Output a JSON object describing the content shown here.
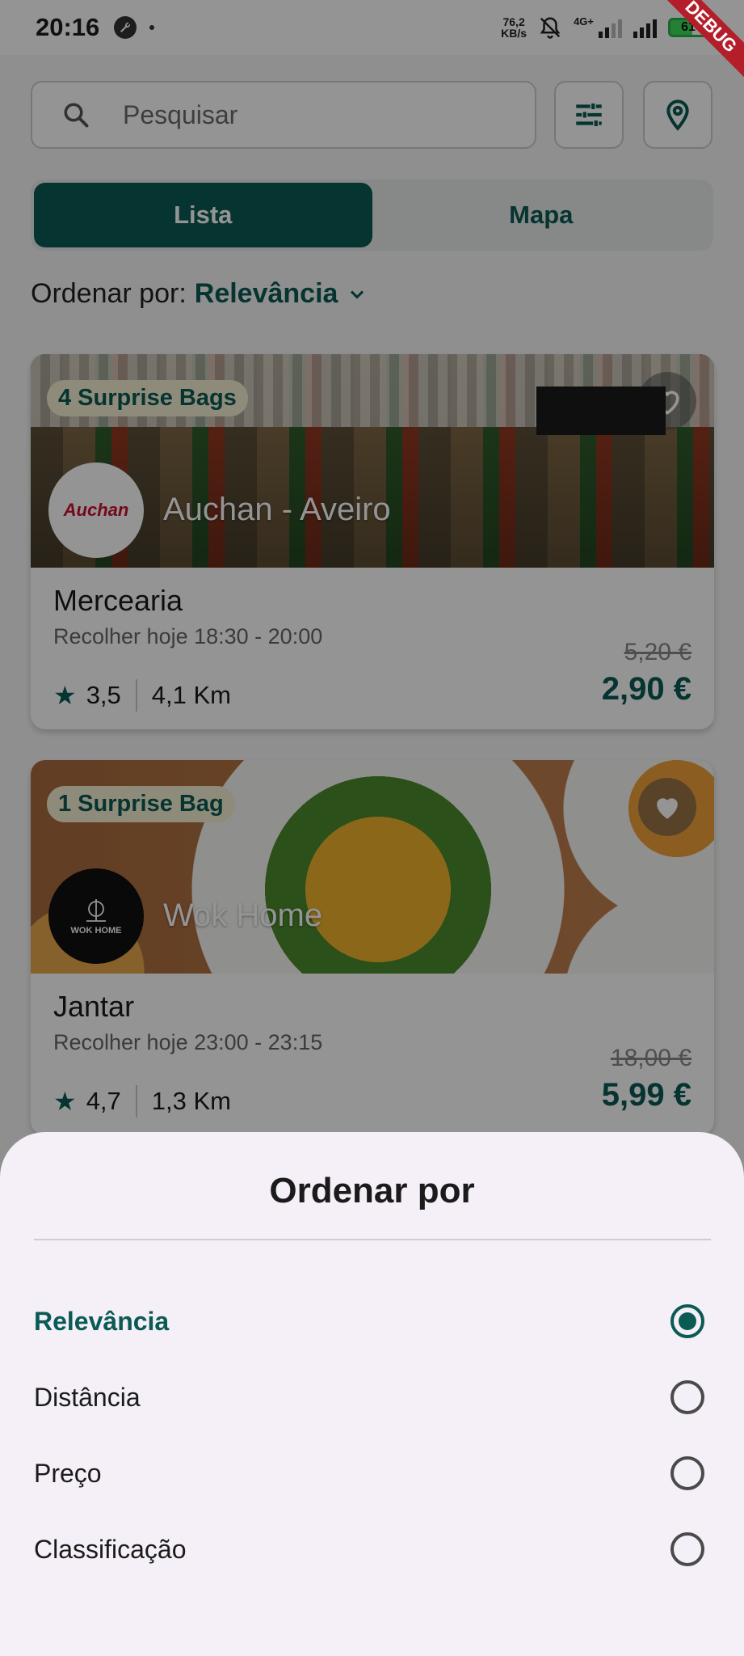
{
  "status_bar": {
    "time": "20:16",
    "net_speed_value": "76,2",
    "net_speed_unit": "KB/s",
    "network": "4G+",
    "battery": "61"
  },
  "debug_banner": "DEBUG",
  "search": {
    "placeholder": "Pesquisar"
  },
  "view_toggle": {
    "list_label": "Lista",
    "map_label": "Mapa",
    "active": "Lista"
  },
  "sort": {
    "label": "Ordenar por:",
    "value": "Relevância"
  },
  "cards": [
    {
      "badge": "4 Surprise Bags",
      "logo_text": "Auchan",
      "store": "Auchan - Aveiro",
      "title": "Mercearia",
      "pickup": "Recolher hoje 18:30 - 20:00",
      "rating": "3,5",
      "distance": "4,1 Km",
      "old_price": "5,20 €",
      "price": "2,90 €"
    },
    {
      "badge": "1 Surprise Bag",
      "logo_text": "WOK HOME",
      "store": "Wok Home",
      "title": "Jantar",
      "pickup": "Recolher hoje 23:00 - 23:15",
      "rating": "4,7",
      "distance": "1,3 Km",
      "old_price": "18,00 €",
      "price": "5,99 €"
    }
  ],
  "sort_sheet": {
    "title": "Ordenar por",
    "options": [
      "Relevância",
      "Distância",
      "Preço",
      "Classificação"
    ],
    "selected": "Relevância"
  },
  "colors": {
    "primary": "#0a5a55",
    "badge_bg": "#f5f0d2",
    "sheet_bg": "#f5eff7"
  }
}
